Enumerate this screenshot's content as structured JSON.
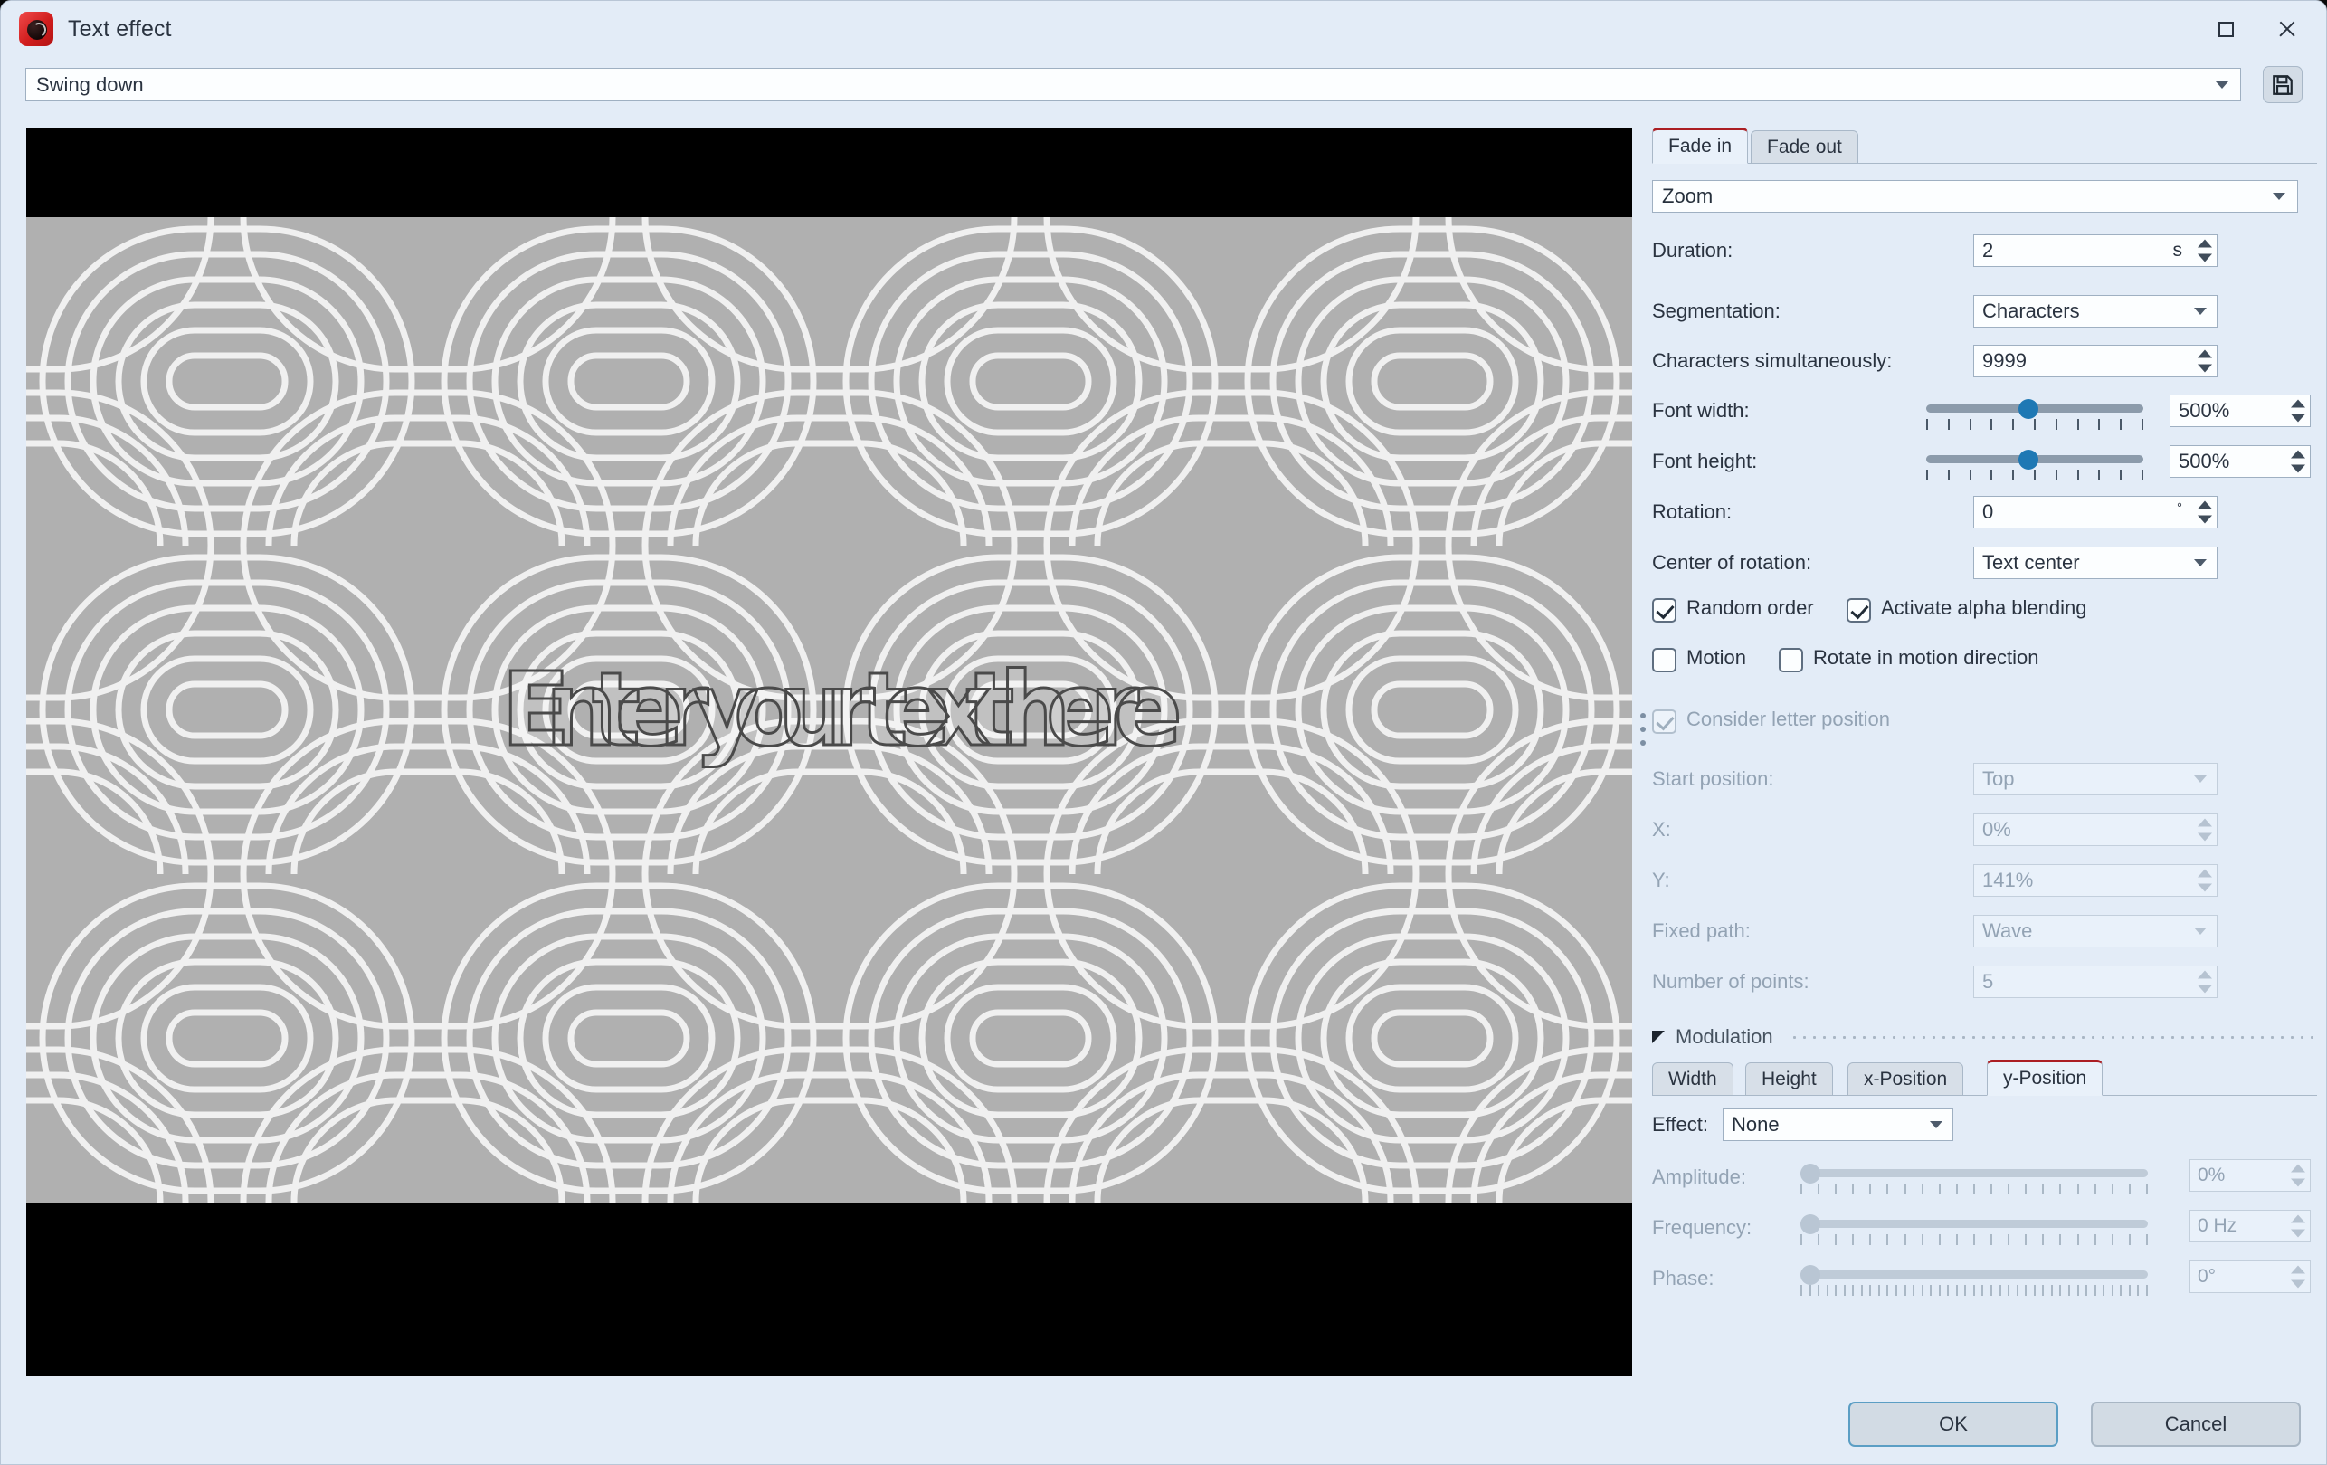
{
  "window": {
    "title": "Text effect",
    "icon": "app-icon",
    "maximize_icon": "maximize-icon",
    "close_icon": "close-icon"
  },
  "preset": {
    "value": "Swing down",
    "save_icon": "save-icon"
  },
  "preview": {
    "text": "Enter your text here",
    "letterbox_color": "#000000",
    "canvas_color": "#b0b0b0"
  },
  "fade_tabs": {
    "items": [
      {
        "label": "Fade in",
        "active": true
      },
      {
        "label": "Fade out",
        "active": false
      }
    ],
    "accent": "#ab1e23"
  },
  "effect": {
    "label": "",
    "value": "Zoom"
  },
  "fields": {
    "duration": {
      "label": "Duration:",
      "value": "2",
      "unit": "s"
    },
    "segmentation": {
      "label": "Segmentation:",
      "value": "Characters"
    },
    "characters_simultaneously": {
      "label": "Characters simultaneously:",
      "value": "9999"
    },
    "font_width": {
      "label": "Font width:",
      "value": "500%",
      "slider_pct": 47
    },
    "font_height": {
      "label": "Font height:",
      "value": "500%",
      "slider_pct": 47
    },
    "rotation": {
      "label": "Rotation:",
      "value": "0",
      "unit": "°"
    },
    "center_of_rotation": {
      "label": "Center of rotation:",
      "value": "Text center"
    },
    "start_position": {
      "label": "Start position:",
      "value": "Top"
    },
    "x": {
      "label": "X:",
      "value": "0%"
    },
    "y": {
      "label": "Y:",
      "value": "141%"
    },
    "fixed_path": {
      "label": "Fixed path:",
      "value": "Wave"
    },
    "number_of_points": {
      "label": "Number of points:",
      "value": "5"
    }
  },
  "checkboxes": {
    "random_order": {
      "label": "Random order",
      "checked": true,
      "disabled": false
    },
    "activate_alpha_blending": {
      "label": "Activate alpha blending",
      "checked": true,
      "disabled": false
    },
    "motion": {
      "label": "Motion",
      "checked": false,
      "disabled": false
    },
    "rotate_in_motion_direction": {
      "label": "Rotate in motion direction",
      "checked": false,
      "disabled": false
    },
    "consider_letter_position": {
      "label": "Consider letter position",
      "checked": true,
      "disabled": true
    }
  },
  "modulation": {
    "title": "Modulation",
    "collapse_icon": "triangle-collapse-icon",
    "tabs": [
      {
        "label": "Width",
        "active": false
      },
      {
        "label": "Height",
        "active": false
      },
      {
        "label": "x-Position",
        "active": false
      },
      {
        "label": "y-Position",
        "active": true
      }
    ],
    "effect": {
      "label": "Effect:",
      "value": "None"
    },
    "amplitude": {
      "label": "Amplitude:",
      "value": "0%",
      "slider_pct": 0
    },
    "frequency": {
      "label": "Frequency:",
      "value": "0 Hz",
      "slider_pct": 0
    },
    "phase": {
      "label": "Phase:",
      "value": "0°",
      "slider_pct": 0
    }
  },
  "footer": {
    "ok": "OK",
    "cancel": "Cancel"
  }
}
